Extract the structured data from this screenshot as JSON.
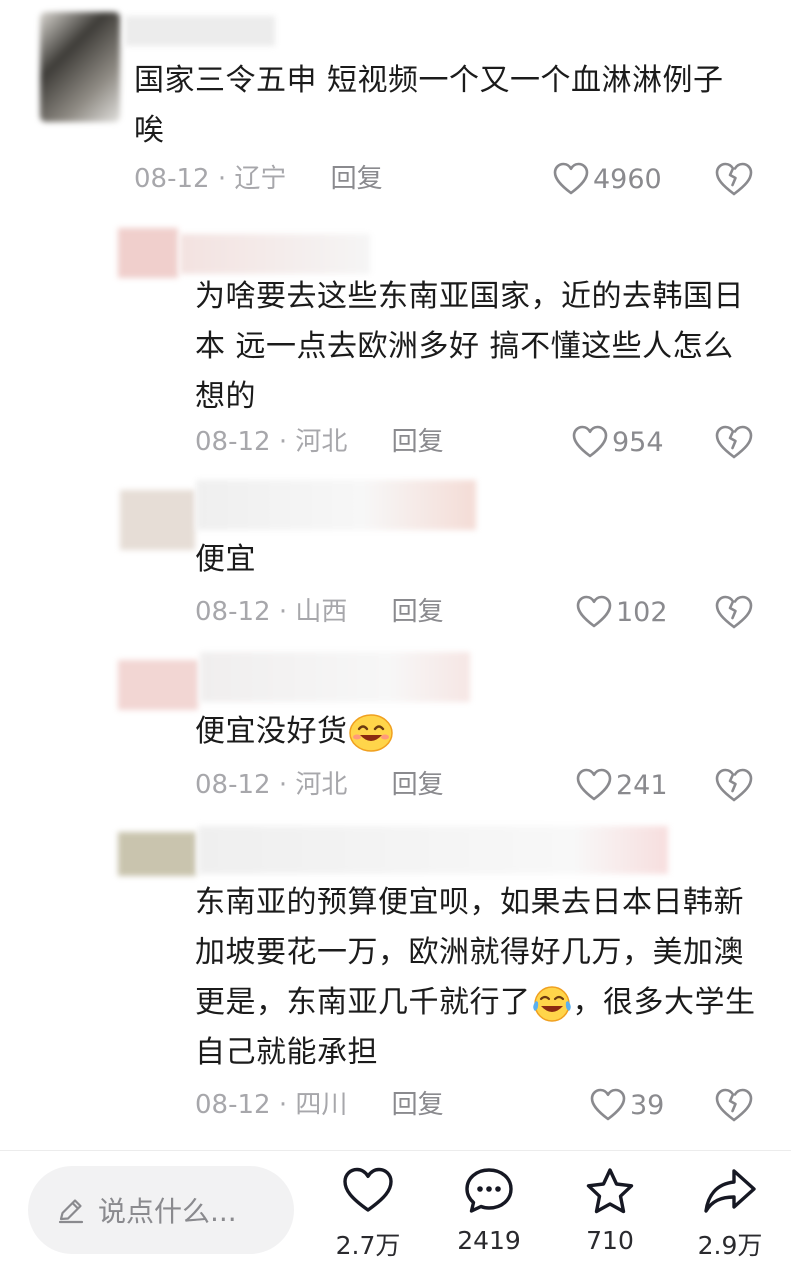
{
  "comments": [
    {
      "text": "国家三令五申 短视频一个又一个血淋淋例子 唉",
      "date": "08-12",
      "location": "辽宁",
      "reply_label": "回复",
      "likes": "4960"
    },
    {
      "text": "为啥要去这些东南亚国家，近的去韩国日本  远一点去欧洲多好  搞不懂这些人怎么想的",
      "date": "08-12",
      "location": "河北",
      "reply_label": "回复",
      "likes": "954"
    },
    {
      "text": "便宜",
      "date": "08-12",
      "location": "山西",
      "reply_label": "回复",
      "likes": "102"
    },
    {
      "text": "便宜没好货",
      "emoji": "laughing-emoji",
      "date": "08-12",
      "location": "河北",
      "reply_label": "回复",
      "likes": "241"
    },
    {
      "text_part1": "东南亚的预算便宜呗，如果去日本日韩新加坡要花一万，欧洲就得好几万，美加澳更是，东南亚几千就行了",
      "emoji": "tears-of-joy-emoji",
      "text_part2": "，很多大学生自己就能承担",
      "date": "08-12",
      "location": "四川",
      "reply_label": "回复",
      "likes": "39"
    }
  ],
  "meta_separator": "·",
  "bottom_bar": {
    "input_placeholder": "说点什么...",
    "like_count": "2.7万",
    "comment_count": "2419",
    "favorite_count": "710",
    "share_count": "2.9万"
  },
  "colors": {
    "text": "#1b1b1b",
    "meta": "#a7a7ab",
    "icon": "#8a8a8e",
    "input_bg": "#f2f2f3"
  }
}
